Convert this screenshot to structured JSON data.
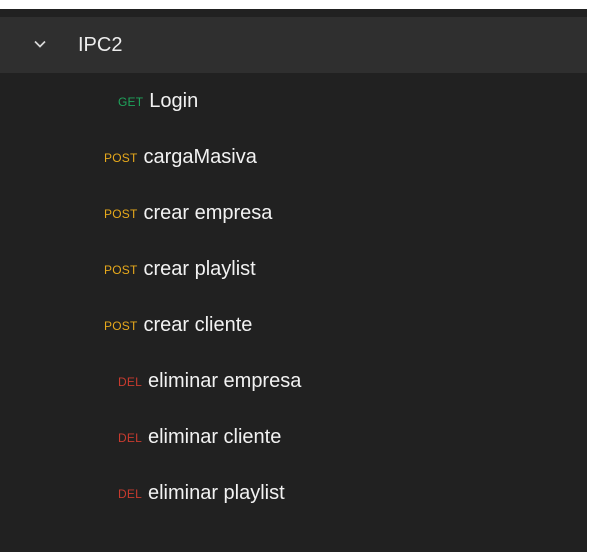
{
  "colors": {
    "panel_bg": "#212121",
    "header_bg": "#2f2f2f",
    "get": "#1fa35b",
    "post": "#e7a91c",
    "del": "#c83b2f",
    "text": "#f2f2f2"
  },
  "collection": {
    "name": "IPC2",
    "expanded": true,
    "toggle_icon": "chevron-down-icon"
  },
  "requests": [
    {
      "method": "GET",
      "name": "Login"
    },
    {
      "method": "POST",
      "name": "cargaMasiva"
    },
    {
      "method": "POST",
      "name": "crear empresa"
    },
    {
      "method": "POST",
      "name": "crear playlist"
    },
    {
      "method": "POST",
      "name": "crear cliente"
    },
    {
      "method": "DEL",
      "name": "eliminar empresa"
    },
    {
      "method": "DEL",
      "name": "eliminar cliente"
    },
    {
      "method": "DEL",
      "name": "eliminar playlist"
    }
  ]
}
